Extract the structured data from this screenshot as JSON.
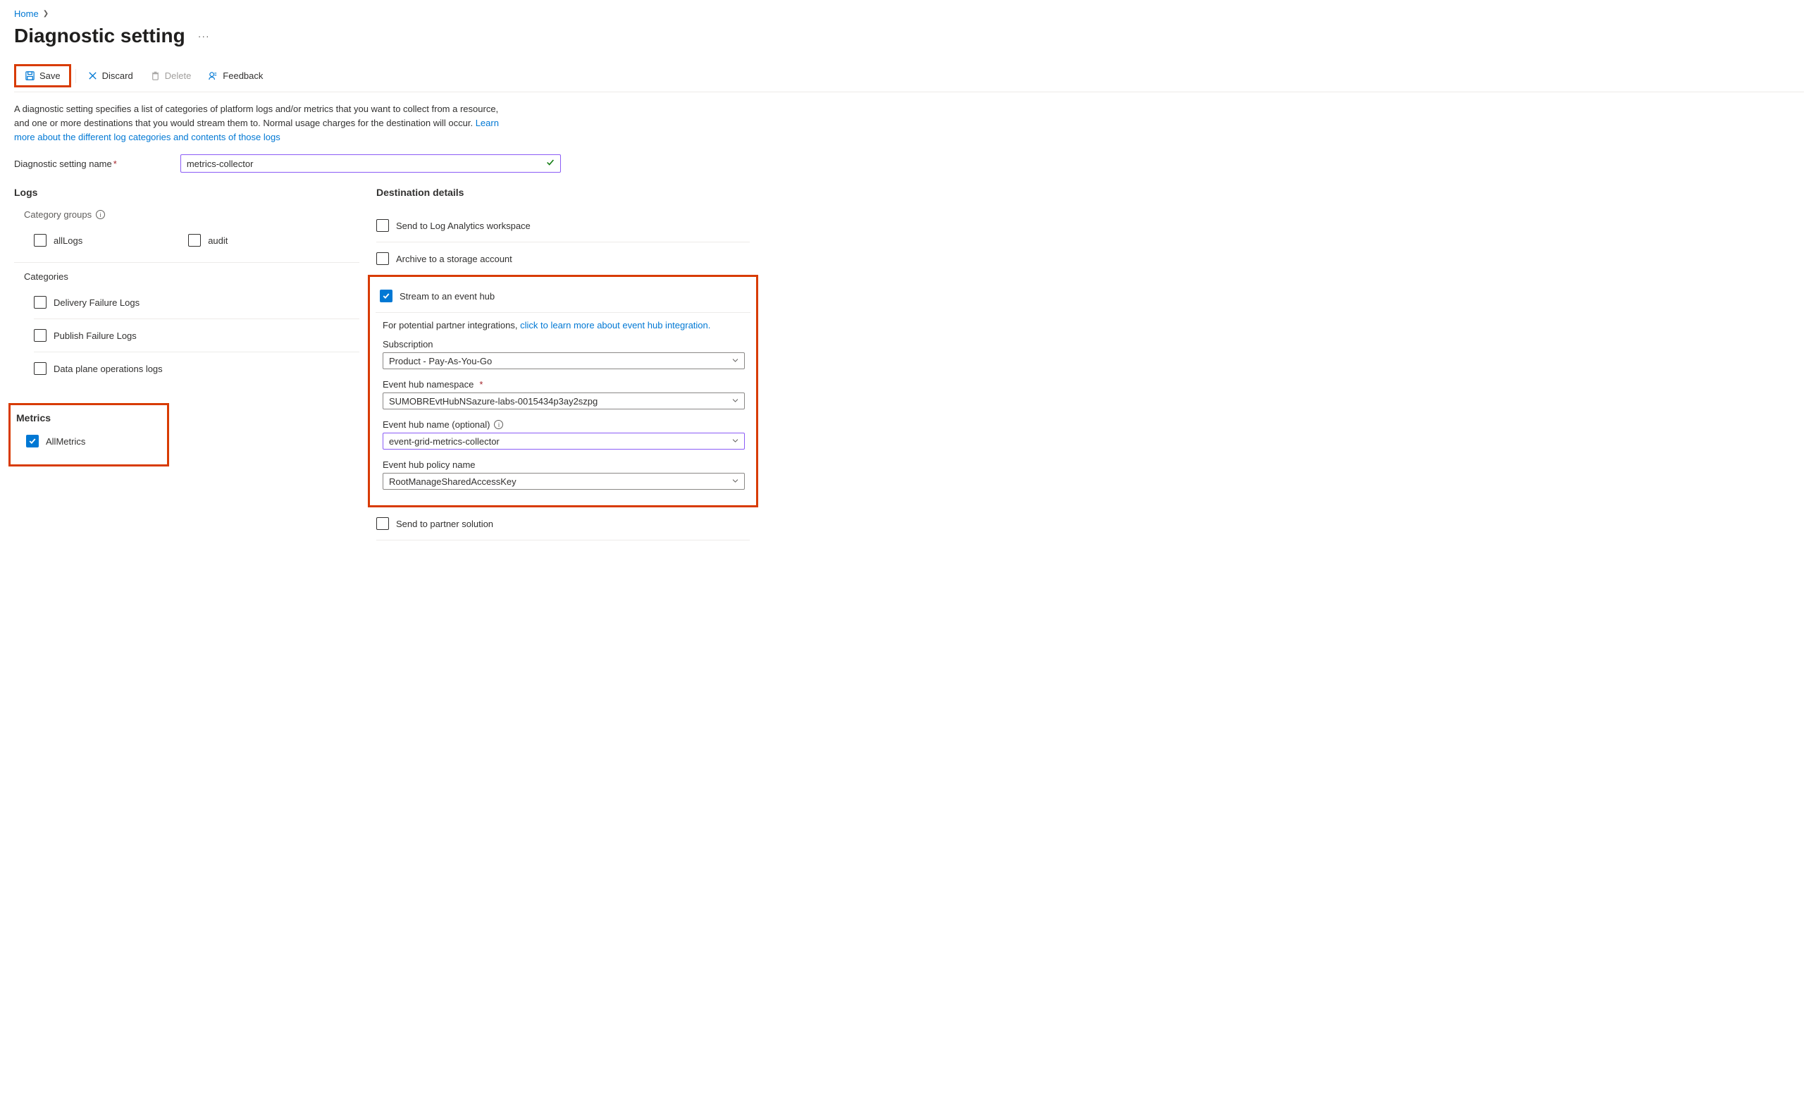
{
  "breadcrumb": {
    "home": "Home"
  },
  "page": {
    "title": "Diagnostic setting"
  },
  "toolbar": {
    "save": "Save",
    "discard": "Discard",
    "delete": "Delete",
    "feedback": "Feedback"
  },
  "description": {
    "text": "A diagnostic setting specifies a list of categories of platform logs and/or metrics that you want to collect from a resource, and one or more destinations that you would stream them to. Normal usage charges for the destination will occur. ",
    "link": "Learn more about the different log categories and contents of those logs"
  },
  "form": {
    "name_label": "Diagnostic setting name",
    "name_value": "metrics-collector"
  },
  "logs": {
    "heading": "Logs",
    "category_groups_label": "Category groups",
    "allLogs": "allLogs",
    "audit": "audit",
    "categories_label": "Categories",
    "categories": {
      "delivery_failure": "Delivery Failure Logs",
      "publish_failure": "Publish Failure Logs",
      "data_plane": "Data plane operations logs"
    }
  },
  "metrics": {
    "heading": "Metrics",
    "all_metrics": "AllMetrics"
  },
  "destinations": {
    "heading": "Destination details",
    "log_analytics": "Send to Log Analytics workspace",
    "storage": "Archive to a storage account",
    "event_hub": "Stream to an event hub",
    "partner": "Send to partner solution",
    "eh_detail": {
      "intro": "For potential partner integrations, ",
      "link": "click to learn more about event hub integration.",
      "subscription_label": "Subscription",
      "subscription_value": "Product - Pay-As-You-Go",
      "namespace_label": "Event hub namespace",
      "namespace_value": "SUMOBREvtHubNSazure-labs-0015434p3ay2szpg",
      "name_label": "Event hub name (optional)",
      "name_value": "event-grid-metrics-collector",
      "policy_label": "Event hub policy name",
      "policy_value": "RootManageSharedAccessKey"
    }
  }
}
